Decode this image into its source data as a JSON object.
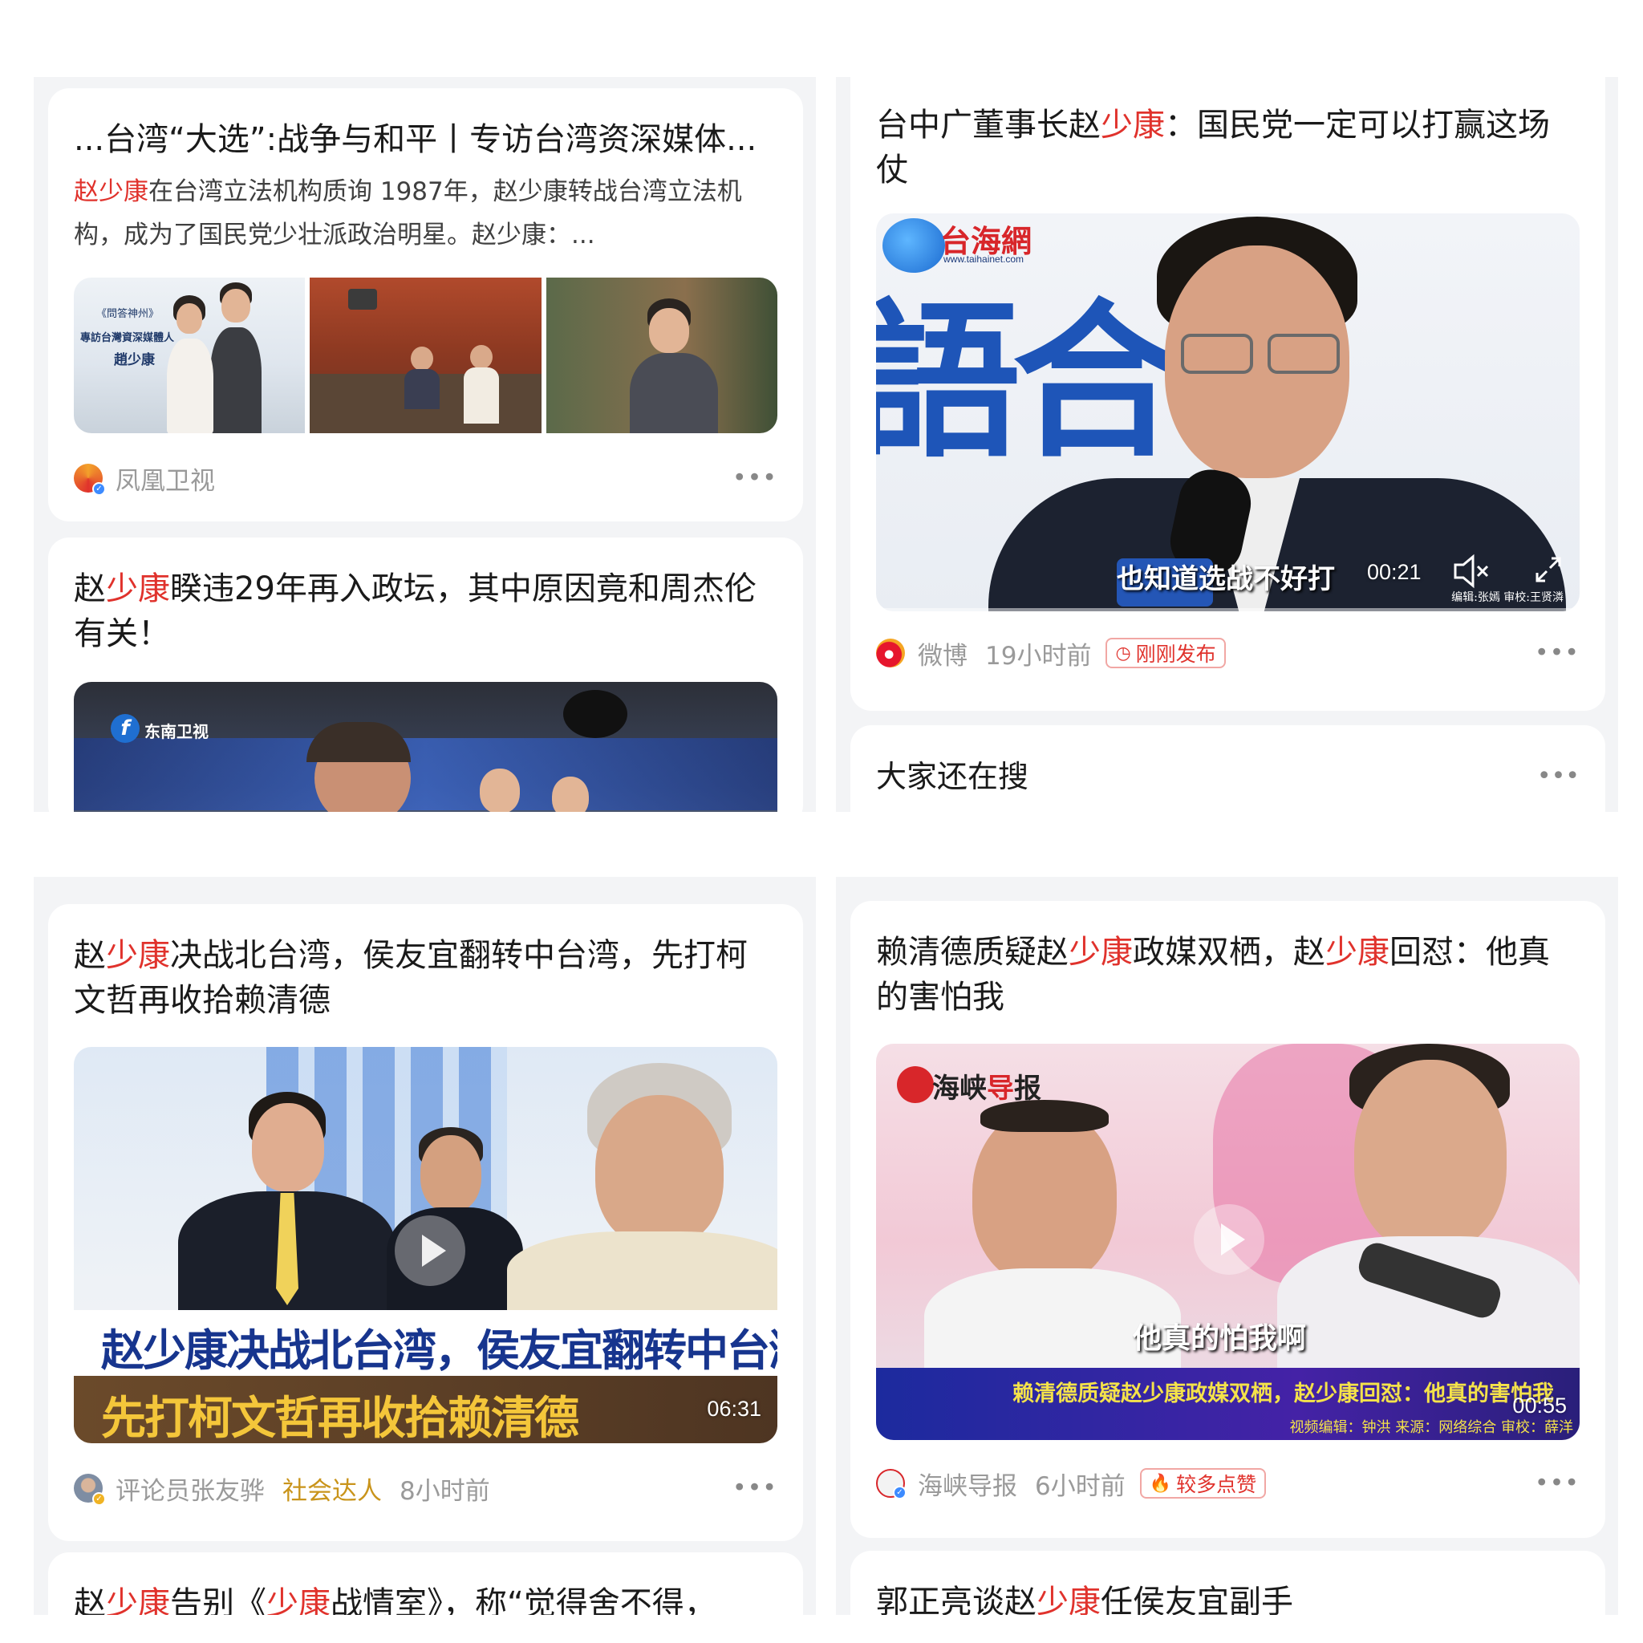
{
  "cards": {
    "c1": {
      "title": "...台湾“大选”:战争与和平丨专访台湾资深媒体...",
      "snippet_hl": "赵少康",
      "snippet_rest": "在台湾立法机构质询 1987年，赵少康转战台湾立法机构，成为了国民党少壮派政治明星。赵少康：...",
      "image_text_1": "《問答神州》",
      "image_text_2": "專訪台灣資深媒體人",
      "image_text_3": "趙少康",
      "source": "凤凰卫视"
    },
    "c2": {
      "title_pre": "赵",
      "title_hl": "少康",
      "title_post": "睽违29年再入政坛，其中原因竟和周杰伦有关！",
      "channel_logo": "东南卫视"
    },
    "c3": {
      "title_pre": "台中广董事长赵",
      "title_hl": "少康",
      "title_post": "：国民党一定可以打赢这场仗",
      "logo": "台海網",
      "logo_url": "www.taihainet.com",
      "backdrop_text": "語合",
      "subtitle": "也知道选战不好打",
      "duration": "00:21",
      "credit": "编辑:张嫣 审校:王贤潾",
      "source": "微博",
      "time": "19小时前",
      "badge": "刚刚发布"
    },
    "c4": {
      "title": "大家还在搜"
    },
    "c5": {
      "title_pre": "赵",
      "title_hl": "少康",
      "title_post": "决战北台湾，侯友宜翻转中台湾，先打柯文哲再收拾赖清德",
      "banner_1": "赵少康决战北台湾，侯友宜翻转中台湾",
      "banner_2": "先打柯文哲再收拾赖清德",
      "duration": "06:31",
      "source": "评论员张友骅",
      "tag": "社会达人",
      "time": "8小时前"
    },
    "c6": {
      "title_a": "赖清德质疑赵",
      "title_hl1": "少康",
      "title_b": "政媒双栖，赵",
      "title_hl2": "少康",
      "title_c": "回怼：他真的害怕我",
      "logo_a": "海峡",
      "logo_b": "导",
      "logo_c": "报",
      "subtitle": "他真的怕我啊",
      "banner": "赖清德质疑赵少康政媒双栖，赵少康回怼：他真的害怕我",
      "duration": "00:55",
      "credit": "视频编辑：钟洪 来源：网络综合 审校：薛洋",
      "source": "海峡导报",
      "time": "6小时前",
      "badge": "较多点赞"
    },
    "c7": {
      "title_pre": "赵",
      "title_hl": "少康",
      "title_mid": "告别《",
      "title_hl2": "少康",
      "title_post": "战情室》，称“觉得舍不得，"
    },
    "c8": {
      "title_pre": "郭正亮谈赵",
      "title_hl": "少康",
      "title_post": "任侯友宜副手"
    }
  },
  "more_icon": "more-dots-icon",
  "colors": {
    "highlight": "#e0322c",
    "panel_bg": "#f3f4f6",
    "card_bg": "#ffffff",
    "meta_text": "#9a9a9a",
    "badge_red": "#e0322c",
    "tag_gold": "#c9941b"
  }
}
